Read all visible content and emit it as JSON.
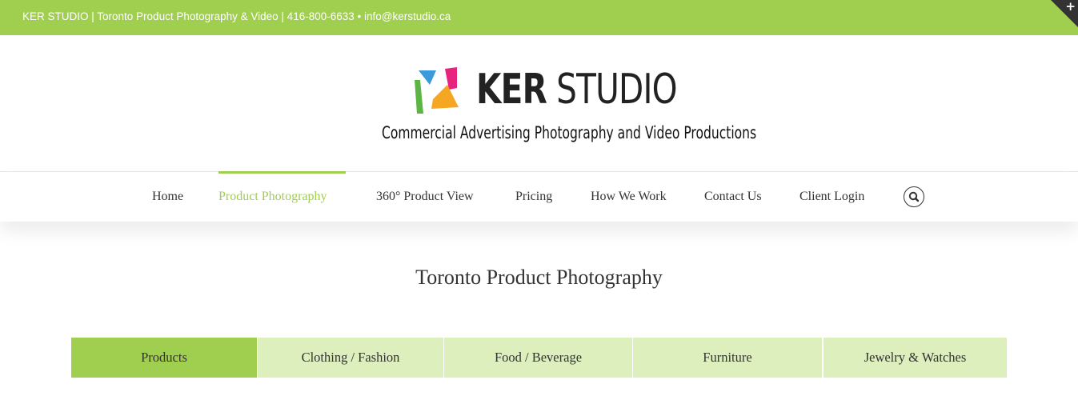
{
  "topbar": {
    "text": "KER STUDIO | Toronto Product Photography & Video | 416-800-6633 • info@kerstudio.ca",
    "corner_icon": "plus-icon",
    "corner_symbol": "+"
  },
  "logo": {
    "name_bold": "KER",
    "name_light": " STUDIO",
    "tagline": "Commercial Advertising Photography and Video Productions",
    "colors": [
      "#3b9ad9",
      "#e8237e",
      "#f5a623",
      "#5cb543"
    ]
  },
  "nav": {
    "items": [
      {
        "label": "Home"
      },
      {
        "label": "Product Photography",
        "active": true
      },
      {
        "label": "360° Product View"
      },
      {
        "label": "Pricing"
      },
      {
        "label": "How We Work"
      },
      {
        "label": "Contact Us"
      },
      {
        "label": "Client Login"
      }
    ],
    "search_icon": "search-icon"
  },
  "page": {
    "title": "Toronto Product Photography"
  },
  "tabs": [
    {
      "label": "Products",
      "active": true
    },
    {
      "label": "Clothing / Fashion"
    },
    {
      "label": "Food / Beverage"
    },
    {
      "label": "Furniture"
    },
    {
      "label": "Jewelry & Watches"
    }
  ],
  "colors": {
    "accent": "#a0ce4e",
    "tab_inactive": "#dcefbd",
    "text": "#333333"
  }
}
